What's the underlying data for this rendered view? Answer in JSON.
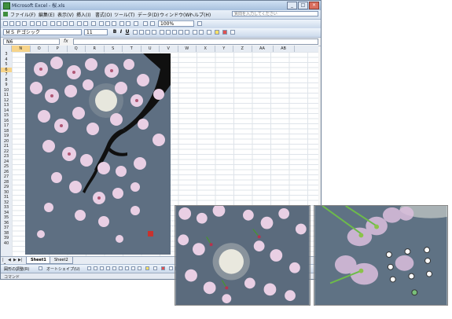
{
  "window": {
    "title": "Microsoft Excel - 桜.xls",
    "controls": [
      "_",
      "□",
      "×"
    ]
  },
  "menu": {
    "items": [
      "ファイル(F)",
      "編集(E)",
      "表示(V)",
      "挿入(I)",
      "書式(O)",
      "ツール(T)",
      "データ(D)",
      "ウィンドウ(W)",
      "ヘルプ(H)"
    ],
    "help_placeholder": "質問を入力してください"
  },
  "toolbar": {
    "zoom": "100%",
    "font": "ＭＳ Ｐゴシック",
    "size": "11",
    "bold": "B",
    "italic": "I",
    "underline": "U"
  },
  "formula_bar": {
    "name_box": "N6",
    "fx": "fx",
    "value": ""
  },
  "grid": {
    "columns": [
      "N",
      "O",
      "P",
      "Q",
      "R",
      "S",
      "T",
      "U",
      "V",
      "W",
      "X",
      "Y",
      "Z",
      "AA",
      "AB"
    ],
    "selected_column": "N",
    "rows": [
      "3",
      "4",
      "5",
      "6",
      "7",
      "8",
      "9",
      "10",
      "11",
      "12",
      "13",
      "14",
      "15",
      "16",
      "17",
      "18",
      "19",
      "20",
      "21",
      "22",
      "23",
      "24",
      "25",
      "26",
      "27",
      "28",
      "29",
      "30",
      "31",
      "32",
      "33",
      "34",
      "35",
      "36",
      "37",
      "38",
      "39",
      "40"
    ]
  },
  "sheets": {
    "nav": [
      "|◀",
      "◀",
      "▶",
      "▶|"
    ],
    "tabs": [
      "Sheet1",
      "Sheet2"
    ]
  },
  "draw_toolbar": {
    "draw_label": "図形の調整(R)",
    "autoshape_label": "オートシェイプ(U)"
  },
  "status": {
    "text": "コマンド"
  },
  "colors": {
    "artwork_bg": "#5e6f82",
    "blossom": "#e9cfe4",
    "branch": "#101010",
    "moon": "#f4f2e6",
    "handle": "#ffffff",
    "handle_green": "#79c07a"
  }
}
